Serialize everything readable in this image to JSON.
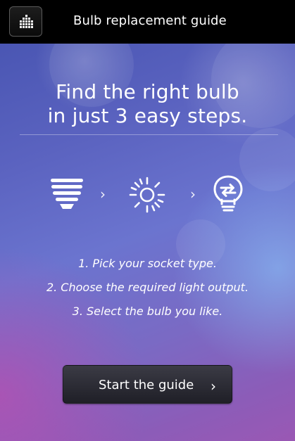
{
  "app": {
    "title": "Bulb replacement guide",
    "logo_icon": "brand-dots-icon"
  },
  "hero": {
    "headline_line1": "Find the right bulb",
    "headline_line2": "in just 3 easy steps."
  },
  "flow_icons": [
    {
      "name": "socket-icon"
    },
    {
      "name": "light-output-icon"
    },
    {
      "name": "bulb-swap-icon"
    }
  ],
  "steps": [
    "1. Pick your socket type.",
    "2. Choose the required light output.",
    "3. Select the bulb you like."
  ],
  "cta": {
    "label": "Start the guide",
    "chevron": "›"
  },
  "colors": {
    "topbar": "#000000",
    "gradient_top": "#4a56b3",
    "gradient_bottom_left": "#9a58b4",
    "button": "#2a2a33"
  }
}
